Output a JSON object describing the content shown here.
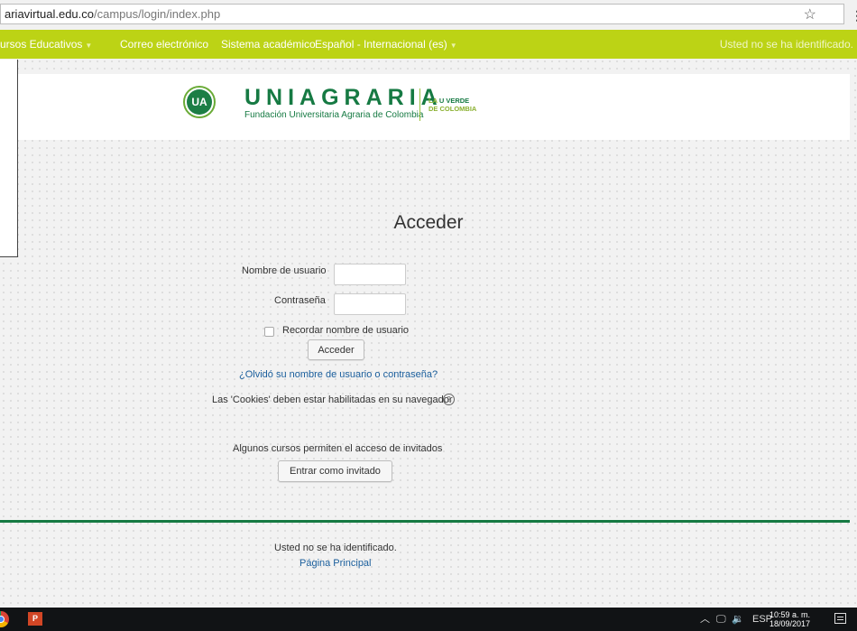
{
  "browser": {
    "url_host": "ariavirtual.edu.co",
    "url_path": "/campus/login/index.php"
  },
  "nav": {
    "items": [
      {
        "label": "ursos Educativos",
        "has_caret": true
      },
      {
        "label": "Correo electrónico"
      },
      {
        "label": "Sistema académico"
      },
      {
        "label": "Español - Internacional (es)",
        "has_caret": true
      }
    ],
    "login_status": "Usted no se ha identificado.",
    "color": "#bcd315"
  },
  "brand": {
    "logo_text": "UA",
    "name": "UNIAGRARIA",
    "subtitle": "Fundación Universitaria Agraria de Colombia",
    "tagline_line1_prefix": "LA ",
    "tagline_line1_bold": "U VERDE",
    "tagline_line2": "DE COLOMBIA",
    "color": "#167a43"
  },
  "login": {
    "title": "Acceder",
    "username_label": "Nombre de usuario",
    "username_value": "",
    "password_label": "Contraseña",
    "password_value": "",
    "remember_label": "Recordar nombre de usuario",
    "remember_checked": false,
    "submit_label": "Acceder",
    "forgot_link": "¿Olvidó su nombre de usuario o contraseña?",
    "cookies_notice": "Las 'Cookies' deben estar habilitadas en su navegador",
    "help_icon": "question-circle-icon",
    "guest_notice": "Algunos cursos permiten el acceso de invitados",
    "guest_button": "Entrar como invitado"
  },
  "footer": {
    "status": "Usted no se ha identificado.",
    "home_link": "Página Principal"
  },
  "taskbar": {
    "language": "ESP",
    "time": "10:59 a. m.",
    "date": "18/09/2017",
    "tray_up_icon": "chevron-up-icon",
    "network_icon": "network-icon",
    "volume_icon": "volume-icon"
  }
}
